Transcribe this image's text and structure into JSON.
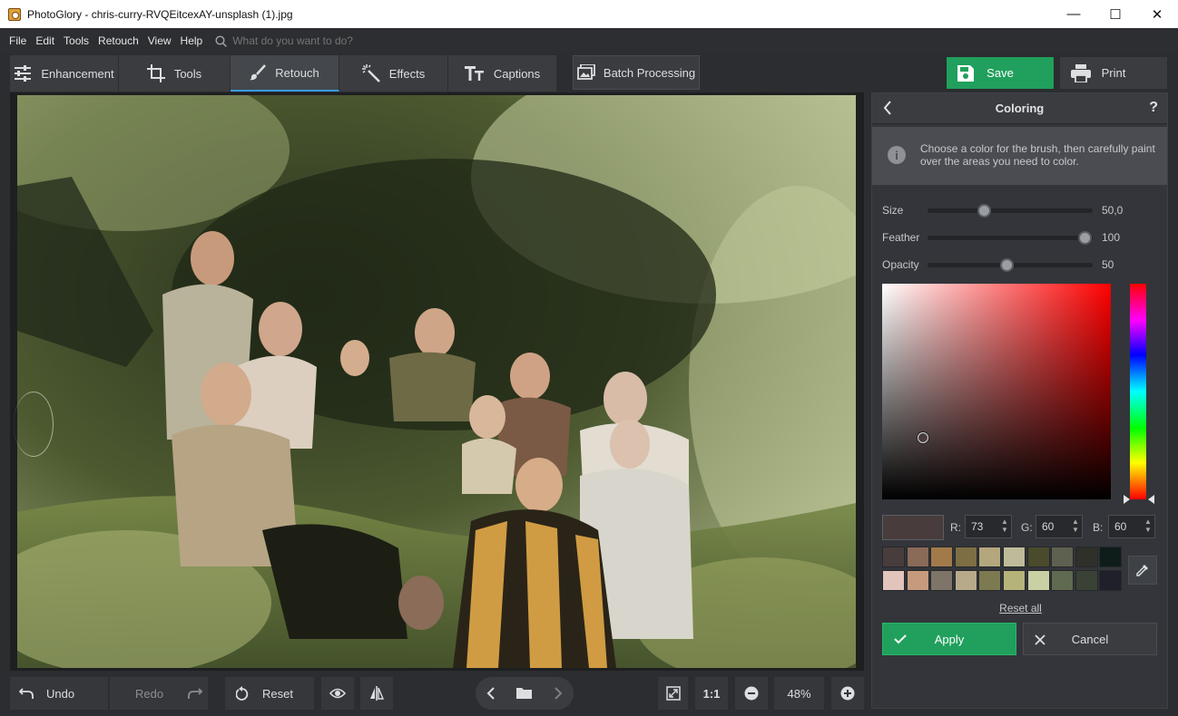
{
  "window": {
    "title": "PhotoGlory - chris-curry-RVQEitcexAY-unsplash (1).jpg",
    "controls": {
      "minimize": "—",
      "maximize": "☐",
      "close": "✕"
    }
  },
  "menu": {
    "items": [
      "File",
      "Edit",
      "Tools",
      "Retouch",
      "View",
      "Help"
    ],
    "search_placeholder": "What do you want to do?"
  },
  "toolbar": {
    "tabs": [
      {
        "label": "Enhancement",
        "icon": "sliders-icon",
        "active": false
      },
      {
        "label": "Tools",
        "icon": "crop-icon",
        "active": false
      },
      {
        "label": "Retouch",
        "icon": "brush-icon",
        "active": true
      },
      {
        "label": "Effects",
        "icon": "magic-wand-icon",
        "active": false
      },
      {
        "label": "Captions",
        "icon": "text-icon",
        "active": false
      }
    ],
    "batch_label": "Batch Processing",
    "save_label": "Save",
    "print_label": "Print"
  },
  "panel": {
    "title": "Coloring",
    "help": "?",
    "info_text": "Choose a color for the brush, then carefully paint over the areas you need to color.",
    "sliders": [
      {
        "label": "Size",
        "value": "50,0",
        "fraction": 0.34
      },
      {
        "label": "Feather",
        "value": "100",
        "fraction": 0.95
      },
      {
        "label": "Opacity",
        "value": "50",
        "fraction": 0.48
      }
    ],
    "rgb": {
      "r_label": "R:",
      "r": "73",
      "g_label": "G:",
      "g": "60",
      "b_label": "B:",
      "b": "60"
    },
    "current_color": "#493c3c",
    "swatch_colors": [
      [
        "#493c3c",
        "#8a6a58",
        "#a27a4a",
        "#7d6e44",
        "#b4a77e",
        "#bfbb9a",
        "#4a4a2c",
        "#5e6150",
        "#2e3029",
        "#0e1d1a"
      ],
      [
        "#e2c4bc",
        "#c69a7c",
        "#7e7468",
        "#b7aa8a",
        "#7d7a52",
        "#b6b37a",
        "#c8d0a4",
        "#5f6a50",
        "#3a4236",
        "#20202a"
      ]
    ],
    "reset_all": "Reset all",
    "apply_label": "Apply",
    "cancel_label": "Cancel"
  },
  "bottom": {
    "undo_label": "Undo",
    "redo_label": "Redo",
    "reset_label": "Reset",
    "one_to_one": "1:1",
    "zoom": "48%"
  },
  "colors": {
    "accent_green": "#20a05c",
    "accent_blue": "#3b9be6"
  }
}
